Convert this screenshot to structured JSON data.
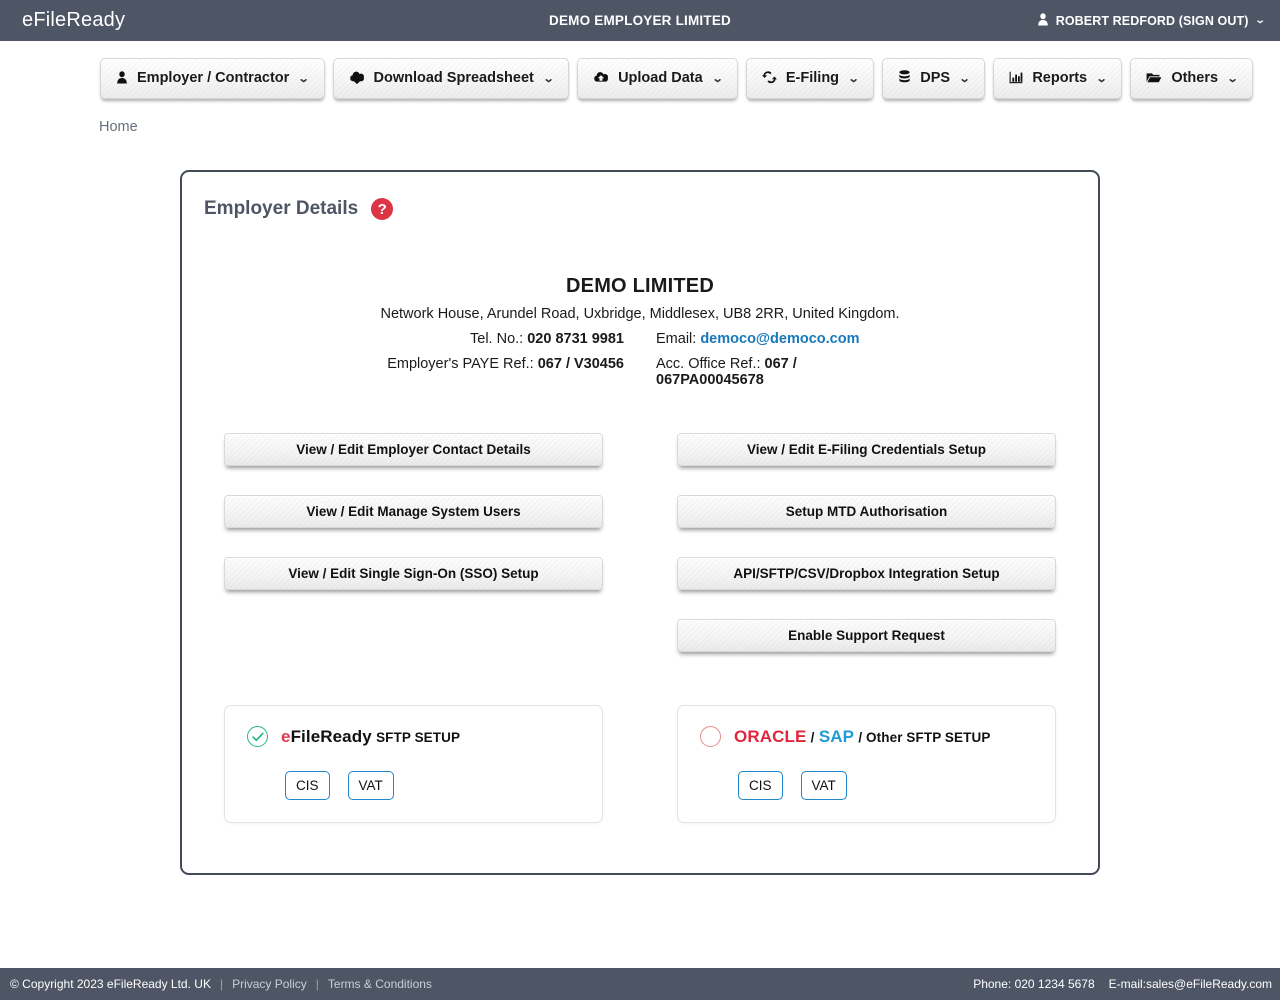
{
  "topbar": {
    "brand": "eFileReady",
    "center_title": "DEMO EMPLOYER LIMITED",
    "user_label": "ROBERT REDFORD (SIGN OUT)",
    "user_icon": "user-icon",
    "caret_icon": "chevron-down-icon",
    "bg_color": "#4e5564"
  },
  "nav": {
    "items": [
      {
        "label": "Employer / Contractor",
        "icon": "user-icon"
      },
      {
        "label": "Download Spreadsheet",
        "icon": "cloud-download-icon"
      },
      {
        "label": "Upload Data",
        "icon": "cloud-upload-icon"
      },
      {
        "label": "E-Filing",
        "icon": "exchange-arrows-icon"
      },
      {
        "label": "DPS",
        "icon": "database-icon"
      },
      {
        "label": "Reports",
        "icon": "bar-chart-icon"
      },
      {
        "label": "Others",
        "icon": "folder-open-icon"
      }
    ]
  },
  "breadcrumb": {
    "label": "Home"
  },
  "panel": {
    "title": "Employer Details",
    "help_icon": "question-mark-icon",
    "help_color": "#dc3545",
    "border_color": "#434a58"
  },
  "company": {
    "name": "DEMO LIMITED",
    "address": "Network House, Arundel Road, Uxbridge, Middlesex, UB8 2RR, United Kingdom.",
    "tel_label": "Tel. No.:",
    "tel_value": "020 8731 9981",
    "email_label": "Email:",
    "email_value": "democo@democo.com",
    "email_color": "#1779ba",
    "paye_label": "Employer's PAYE Ref.:",
    "paye_value": "067 / V30456",
    "acc_label": "Acc. Office Ref.:",
    "acc_value": "067 / 067PA00045678"
  },
  "actions": {
    "left": [
      "View / Edit Employer Contact Details",
      "View / Edit Manage System Users",
      "View / Edit Single Sign-On (SSO) Setup"
    ],
    "right": [
      "View / Edit E-Filing Credentials Setup",
      "Setup MTD Authorisation",
      "API/SFTP/CSV/Dropbox Integration Setup",
      "Enable Support Request"
    ]
  },
  "cards": {
    "left": {
      "state_icon": "check-circle-icon",
      "selected": "true",
      "title_brand_e": "e",
      "title_brand_rest": "FileReady",
      "title_suffix": "SFTP SETUP",
      "buttons": [
        "CIS",
        "VAT"
      ],
      "check_color": "#26b58c"
    },
    "right": {
      "state_icon": "radio-unchecked-icon",
      "selected": "false",
      "title_oracle": "ORACLE",
      "title_sep1": "/",
      "title_sap": "SAP",
      "title_suffix": "/ Other SFTP SETUP",
      "buttons": [
        "CIS",
        "VAT"
      ],
      "oracle_color": "#e0263e",
      "sap_color": "#1e9bd7"
    }
  },
  "footer": {
    "copyright": "© Copyright 2023  eFileReady Ltd. UK",
    "privacy": "Privacy Policy",
    "terms": "Terms & Conditions",
    "phone": "Phone: 020 1234 5678",
    "email": "E-mail:sales@eFileReady.com",
    "bg_color": "#4e5564"
  }
}
